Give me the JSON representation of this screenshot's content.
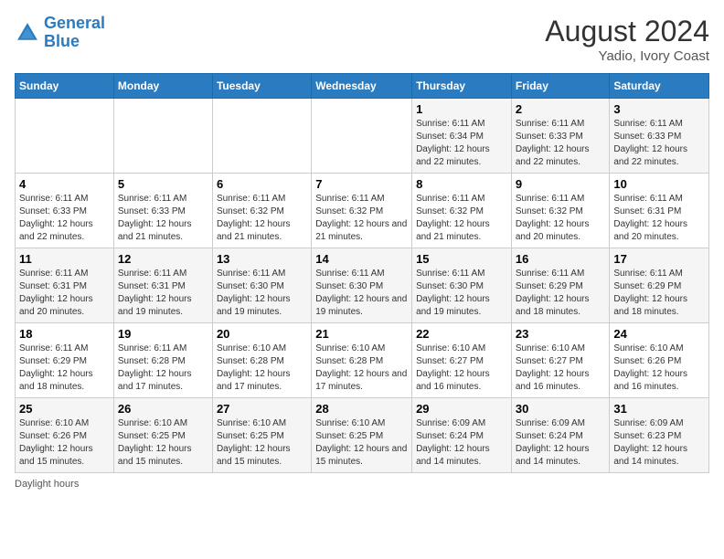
{
  "header": {
    "logo_line1": "General",
    "logo_line2": "Blue",
    "title": "August 2024",
    "subtitle": "Yadio, Ivory Coast"
  },
  "weekdays": [
    "Sunday",
    "Monday",
    "Tuesday",
    "Wednesday",
    "Thursday",
    "Friday",
    "Saturday"
  ],
  "weeks": [
    [
      {
        "day": "",
        "info": ""
      },
      {
        "day": "",
        "info": ""
      },
      {
        "day": "",
        "info": ""
      },
      {
        "day": "",
        "info": ""
      },
      {
        "day": "1",
        "info": "Sunrise: 6:11 AM\nSunset: 6:34 PM\nDaylight: 12 hours and 22 minutes."
      },
      {
        "day": "2",
        "info": "Sunrise: 6:11 AM\nSunset: 6:33 PM\nDaylight: 12 hours and 22 minutes."
      },
      {
        "day": "3",
        "info": "Sunrise: 6:11 AM\nSunset: 6:33 PM\nDaylight: 12 hours and 22 minutes."
      }
    ],
    [
      {
        "day": "4",
        "info": "Sunrise: 6:11 AM\nSunset: 6:33 PM\nDaylight: 12 hours and 22 minutes."
      },
      {
        "day": "5",
        "info": "Sunrise: 6:11 AM\nSunset: 6:33 PM\nDaylight: 12 hours and 21 minutes."
      },
      {
        "day": "6",
        "info": "Sunrise: 6:11 AM\nSunset: 6:32 PM\nDaylight: 12 hours and 21 minutes."
      },
      {
        "day": "7",
        "info": "Sunrise: 6:11 AM\nSunset: 6:32 PM\nDaylight: 12 hours and 21 minutes."
      },
      {
        "day": "8",
        "info": "Sunrise: 6:11 AM\nSunset: 6:32 PM\nDaylight: 12 hours and 21 minutes."
      },
      {
        "day": "9",
        "info": "Sunrise: 6:11 AM\nSunset: 6:32 PM\nDaylight: 12 hours and 20 minutes."
      },
      {
        "day": "10",
        "info": "Sunrise: 6:11 AM\nSunset: 6:31 PM\nDaylight: 12 hours and 20 minutes."
      }
    ],
    [
      {
        "day": "11",
        "info": "Sunrise: 6:11 AM\nSunset: 6:31 PM\nDaylight: 12 hours and 20 minutes."
      },
      {
        "day": "12",
        "info": "Sunrise: 6:11 AM\nSunset: 6:31 PM\nDaylight: 12 hours and 19 minutes."
      },
      {
        "day": "13",
        "info": "Sunrise: 6:11 AM\nSunset: 6:30 PM\nDaylight: 12 hours and 19 minutes."
      },
      {
        "day": "14",
        "info": "Sunrise: 6:11 AM\nSunset: 6:30 PM\nDaylight: 12 hours and 19 minutes."
      },
      {
        "day": "15",
        "info": "Sunrise: 6:11 AM\nSunset: 6:30 PM\nDaylight: 12 hours and 19 minutes."
      },
      {
        "day": "16",
        "info": "Sunrise: 6:11 AM\nSunset: 6:29 PM\nDaylight: 12 hours and 18 minutes."
      },
      {
        "day": "17",
        "info": "Sunrise: 6:11 AM\nSunset: 6:29 PM\nDaylight: 12 hours and 18 minutes."
      }
    ],
    [
      {
        "day": "18",
        "info": "Sunrise: 6:11 AM\nSunset: 6:29 PM\nDaylight: 12 hours and 18 minutes."
      },
      {
        "day": "19",
        "info": "Sunrise: 6:11 AM\nSunset: 6:28 PM\nDaylight: 12 hours and 17 minutes."
      },
      {
        "day": "20",
        "info": "Sunrise: 6:10 AM\nSunset: 6:28 PM\nDaylight: 12 hours and 17 minutes."
      },
      {
        "day": "21",
        "info": "Sunrise: 6:10 AM\nSunset: 6:28 PM\nDaylight: 12 hours and 17 minutes."
      },
      {
        "day": "22",
        "info": "Sunrise: 6:10 AM\nSunset: 6:27 PM\nDaylight: 12 hours and 16 minutes."
      },
      {
        "day": "23",
        "info": "Sunrise: 6:10 AM\nSunset: 6:27 PM\nDaylight: 12 hours and 16 minutes."
      },
      {
        "day": "24",
        "info": "Sunrise: 6:10 AM\nSunset: 6:26 PM\nDaylight: 12 hours and 16 minutes."
      }
    ],
    [
      {
        "day": "25",
        "info": "Sunrise: 6:10 AM\nSunset: 6:26 PM\nDaylight: 12 hours and 15 minutes."
      },
      {
        "day": "26",
        "info": "Sunrise: 6:10 AM\nSunset: 6:25 PM\nDaylight: 12 hours and 15 minutes."
      },
      {
        "day": "27",
        "info": "Sunrise: 6:10 AM\nSunset: 6:25 PM\nDaylight: 12 hours and 15 minutes."
      },
      {
        "day": "28",
        "info": "Sunrise: 6:10 AM\nSunset: 6:25 PM\nDaylight: 12 hours and 15 minutes."
      },
      {
        "day": "29",
        "info": "Sunrise: 6:09 AM\nSunset: 6:24 PM\nDaylight: 12 hours and 14 minutes."
      },
      {
        "day": "30",
        "info": "Sunrise: 6:09 AM\nSunset: 6:24 PM\nDaylight: 12 hours and 14 minutes."
      },
      {
        "day": "31",
        "info": "Sunrise: 6:09 AM\nSunset: 6:23 PM\nDaylight: 12 hours and 14 minutes."
      }
    ]
  ],
  "footer": {
    "daylight_label": "Daylight hours"
  }
}
